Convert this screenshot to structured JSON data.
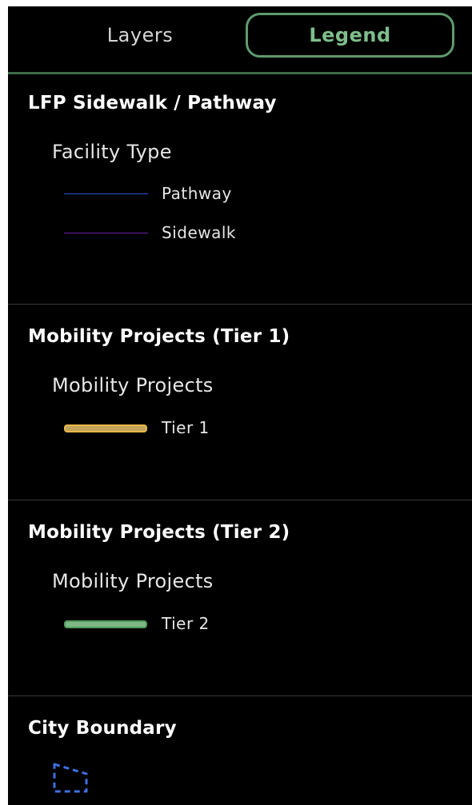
{
  "tabs": {
    "layers_label": "Layers",
    "legend_label": "Legend",
    "active": "Legend"
  },
  "colors": {
    "background": "#000000",
    "accent_green": "#5f9a6e",
    "pathway": "#2f4fd8",
    "sidewalk": "#6a1fb0",
    "tier1_fill": "#c4a45a",
    "tier1_stroke": "#e8b94a",
    "tier2_fill": "#7fb887",
    "tier2_stroke": "#4f9a5e",
    "boundary": "#3f6fe0"
  },
  "legend": {
    "sections": [
      {
        "title": "LFP Sidewalk / Pathway",
        "group": "Facility Type",
        "items": [
          {
            "label": "Pathway",
            "icon": "thin-line"
          },
          {
            "label": "Sidewalk",
            "icon": "thin-line"
          }
        ]
      },
      {
        "title": "Mobility Projects (Tier 1)",
        "group": "Mobility Projects",
        "items": [
          {
            "label": "Tier 1",
            "icon": "pill-line"
          }
        ]
      },
      {
        "title": "Mobility Projects (Tier 2)",
        "group": "Mobility Projects",
        "items": [
          {
            "label": "Tier 2",
            "icon": "pill-line"
          }
        ]
      },
      {
        "title": "City Boundary",
        "icon": "dashed-polygon-icon"
      }
    ]
  }
}
